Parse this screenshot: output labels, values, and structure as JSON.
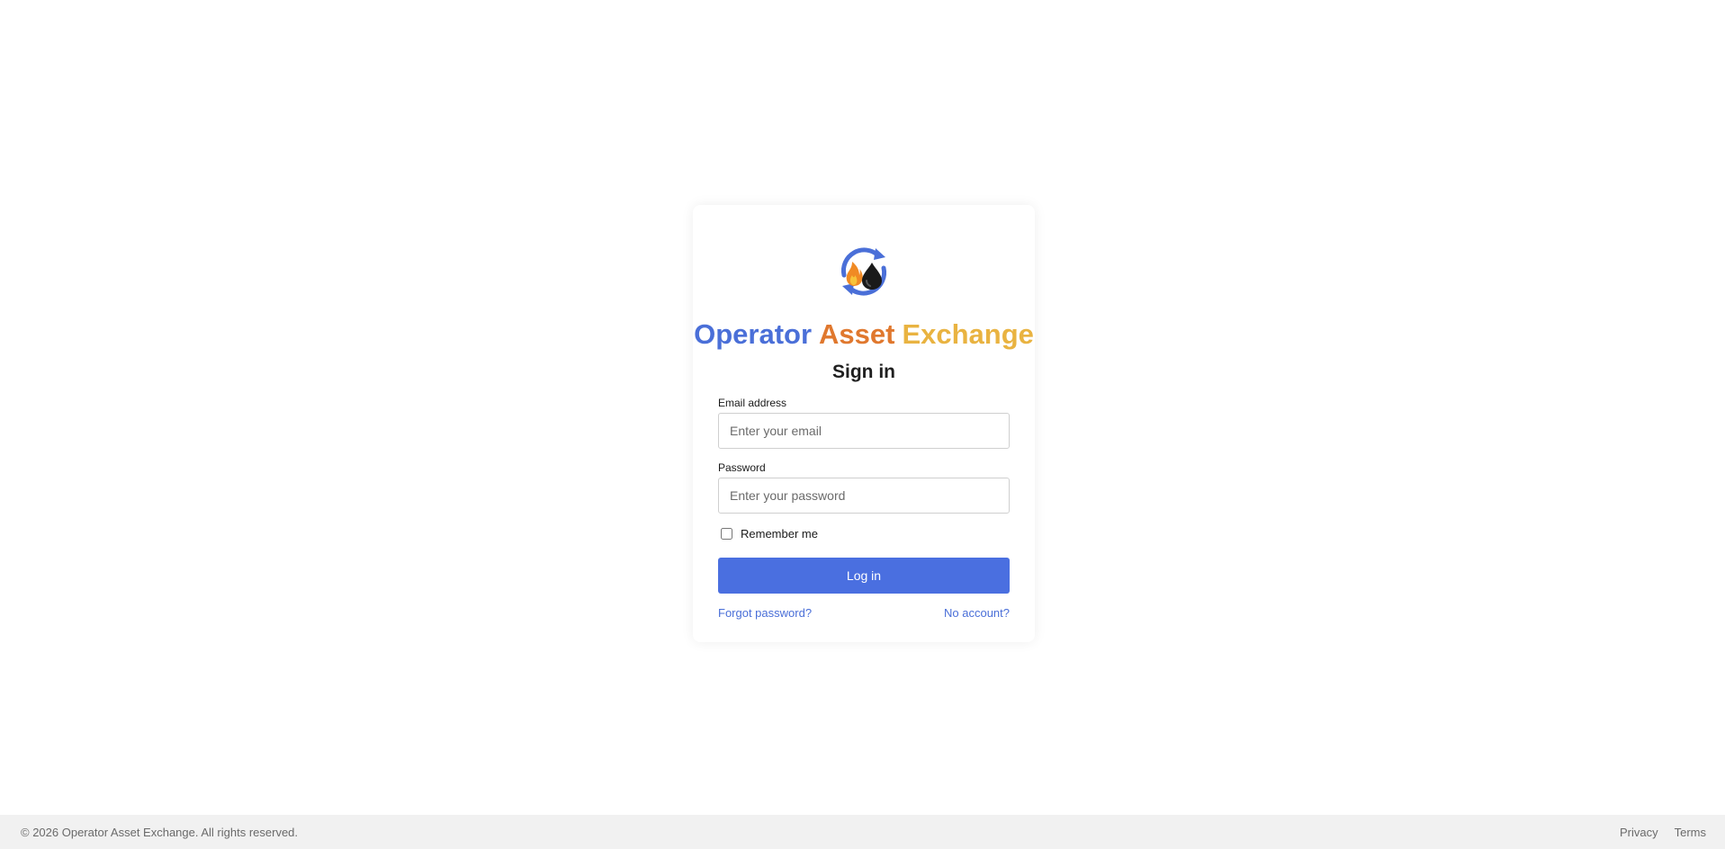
{
  "brand": {
    "words": [
      {
        "text": "Operator",
        "color": "#4a6fd8"
      },
      {
        "text": "Asset",
        "color": "#e0782e"
      },
      {
        "text": "Exchange",
        "color": "#e9b341"
      }
    ],
    "logo_icon": "cycle-flame-oil-drop-icon"
  },
  "form": {
    "heading": "Sign in",
    "email_label": "Email address",
    "email_placeholder": "Enter your email",
    "email_value": "",
    "password_label": "Password",
    "password_placeholder": "Enter your password",
    "password_value": "",
    "remember_label": "Remember me",
    "remember_checked": false,
    "submit_label": "Log in",
    "forgot_link": "Forgot password?",
    "signup_link": "No account?"
  },
  "footer": {
    "copyright": "© 2026 Operator Asset Exchange. All rights reserved.",
    "privacy": "Privacy",
    "terms": "Terms"
  },
  "colors": {
    "accent": "#4a6fe0",
    "link": "#4a6fd8",
    "footer_bg": "#f1f1f1"
  }
}
